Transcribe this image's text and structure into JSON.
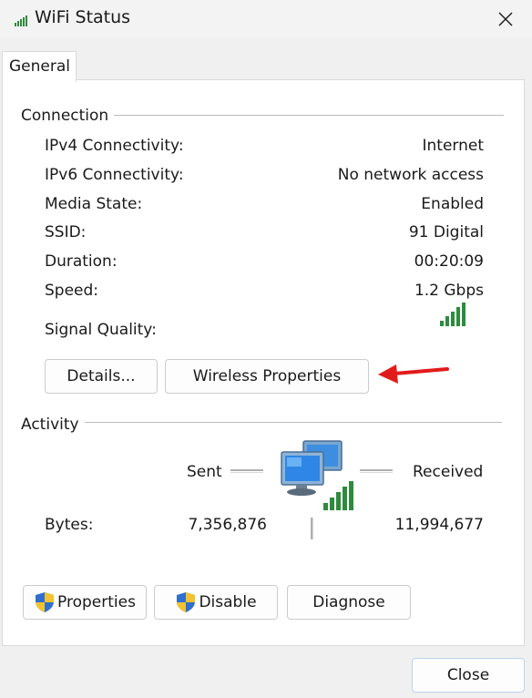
{
  "window": {
    "title": "WiFi Status",
    "icon": "wifi-signal-icon"
  },
  "tabs": [
    {
      "label": "General",
      "selected": true
    }
  ],
  "connection": {
    "heading": "Connection",
    "rows": [
      {
        "label": "IPv4 Connectivity:",
        "value": "Internet"
      },
      {
        "label": "IPv6 Connectivity:",
        "value": "No network access"
      },
      {
        "label": "Media State:",
        "value": "Enabled"
      },
      {
        "label": "SSID:",
        "value": "91 Digital"
      },
      {
        "label": "Duration:",
        "value": "00:20:09"
      },
      {
        "label": "Speed:",
        "value": "1.2 Gbps"
      }
    ],
    "signal_label": "Signal Quality:",
    "signal_bars": 5,
    "signal_bars_total": 5,
    "details_button": "Details...",
    "wireless_button": "Wireless Properties"
  },
  "activity": {
    "heading": "Activity",
    "sent_label": "Sent",
    "received_label": "Received",
    "bytes_label": "Bytes:",
    "bytes_sent": "7,356,876",
    "bytes_received": "11,994,677",
    "network_icon": "network-computers-icon"
  },
  "actions": {
    "properties": "Properties",
    "disable": "Disable",
    "diagnose": "Diagnose"
  },
  "footer": {
    "close_button": "Close"
  },
  "colors": {
    "signal_green": "#2e8b3e",
    "shield_blue": "#2f6fd0",
    "shield_yellow": "#f2c230",
    "arrow_red": "#e11b1b",
    "close_button_border": "#bcd3ea"
  }
}
